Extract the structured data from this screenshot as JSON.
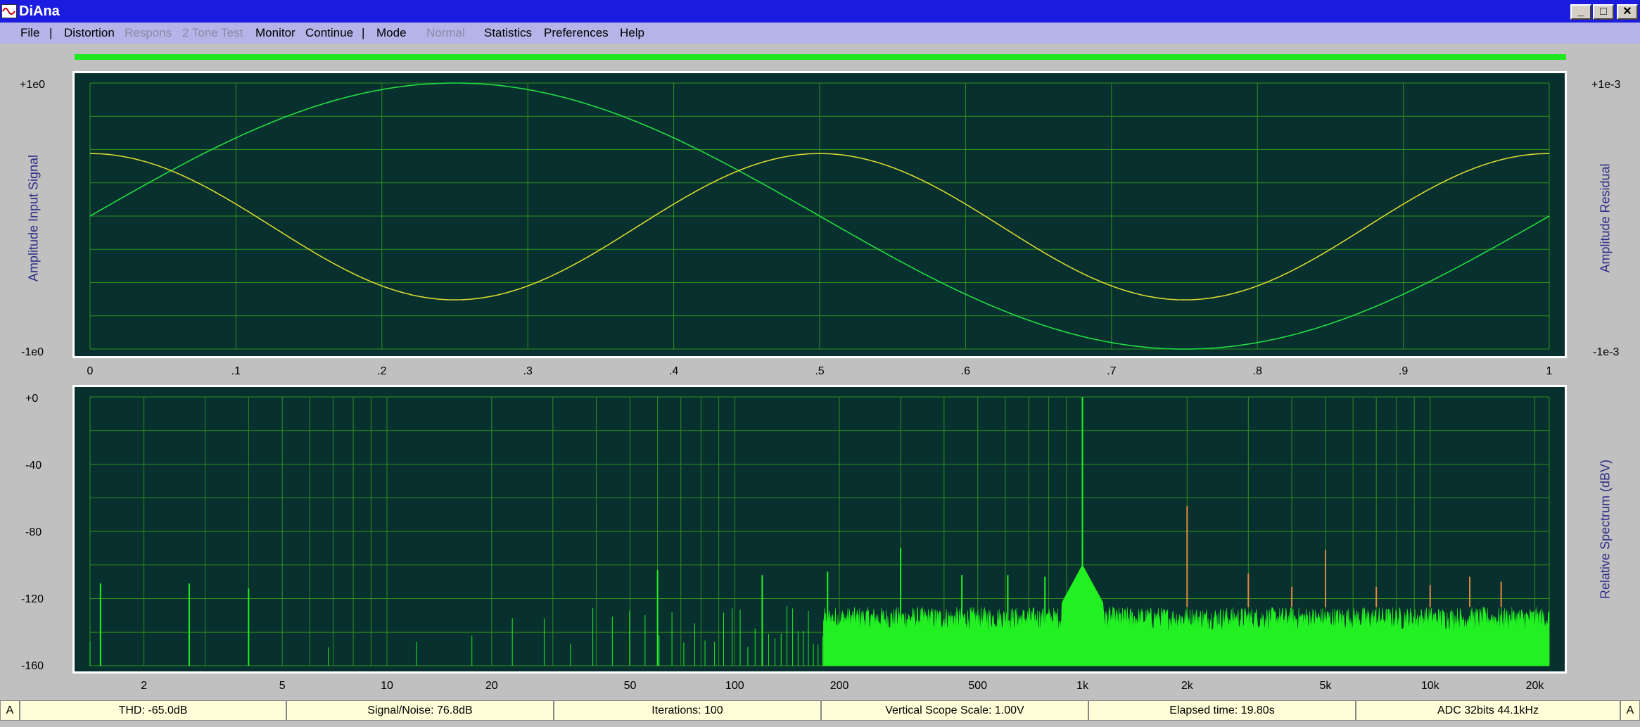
{
  "window": {
    "title": "DiAna",
    "minimize_label": "_",
    "maximize_label": "□",
    "close_label": "✕",
    "icon": "sine-wave-icon"
  },
  "menu": {
    "items": [
      {
        "label": "File",
        "enabled": true
      },
      {
        "label": "|",
        "separator": true
      },
      {
        "label": "Distortion",
        "enabled": true
      },
      {
        "label": "Respons",
        "enabled": false
      },
      {
        "label": "2 Tone Test",
        "enabled": false
      },
      {
        "label": "Monitor",
        "enabled": true
      },
      {
        "label": "Continue",
        "enabled": true
      },
      {
        "label": "|",
        "separator": true
      },
      {
        "label": "Mode",
        "enabled": true
      },
      {
        "label": "Normal",
        "enabled": false
      },
      {
        "label": "Statistics",
        "enabled": true
      },
      {
        "label": "Preferences",
        "enabled": true
      },
      {
        "label": "Help",
        "enabled": true
      }
    ]
  },
  "progress": {
    "fraction": 1.0,
    "color": "#1ee81e"
  },
  "colors": {
    "plot_bg": "#07302e",
    "grid": "#2f8f1f",
    "input_trace": "#22dd44",
    "residual_trace": "#d8d830",
    "spectrum_fill": "#22f022",
    "harmonic_marker": "#e08a40"
  },
  "chart_data": [
    {
      "type": "line",
      "left_axis_title": "Amplitude Input Signal",
      "right_axis_title": "Amplitude Residual",
      "left_ticks": [
        "+1e0",
        "-1e0"
      ],
      "right_ticks": [
        "+1e-3",
        "-1e-3"
      ],
      "x_ticks": [
        "0",
        ".1",
        ".2",
        ".3",
        ".4",
        ".5",
        ".6",
        ".7",
        ".8",
        ".9",
        "1"
      ],
      "xlim": [
        0,
        1
      ],
      "ylim": [
        -1,
        1
      ],
      "grid": true,
      "series": [
        {
          "color": "#22dd44",
          "amplitude": 1.0,
          "cycles": 1,
          "phase_deg": 0,
          "offset": 0
        },
        {
          "color": "#d8d830",
          "amplitude": 0.55,
          "cycles": 2,
          "phase_deg": 90,
          "offset": -0.08
        }
      ]
    },
    {
      "type": "area",
      "right_axis_title": "Relative Spectrum (dBV)",
      "y_ticks": [
        "+0",
        "-40",
        "-80",
        "-120",
        "-160"
      ],
      "ylim": [
        -160,
        0
      ],
      "x_scale": "log",
      "xlim": [
        1.4,
        22000
      ],
      "x_ticks": [
        "2",
        "5",
        "10",
        "20",
        "50",
        "100",
        "200",
        "500",
        "1k",
        "2k",
        "5k",
        "10k",
        "20k"
      ],
      "x_tick_values": [
        2,
        5,
        10,
        20,
        50,
        100,
        200,
        500,
        1000,
        2000,
        5000,
        10000,
        20000
      ],
      "grid": true,
      "fundamental": {
        "freq": 1000,
        "level": 0
      },
      "noise_floor": -128,
      "peaks": [
        {
          "freq": 1000,
          "level": -90
        },
        {
          "freq": 185,
          "level": -104
        },
        {
          "freq": 300,
          "level": -90
        },
        {
          "freq": 450,
          "level": -106
        },
        {
          "freq": 610,
          "level": -106
        },
        {
          "freq": 780,
          "level": -107
        },
        {
          "freq": 60,
          "level": -103
        },
        {
          "freq": 120,
          "level": -106
        },
        {
          "freq": 1.5,
          "level": -111
        },
        {
          "freq": 2.7,
          "level": -111
        },
        {
          "freq": 4,
          "level": -114
        }
      ],
      "harmonics": [
        {
          "freq": 2000,
          "level": -65
        },
        {
          "freq": 3000,
          "level": -105
        },
        {
          "freq": 4000,
          "level": -113
        },
        {
          "freq": 5000,
          "level": -91
        },
        {
          "freq": 7000,
          "level": -113
        },
        {
          "freq": 10000,
          "level": -112
        },
        {
          "freq": 13000,
          "level": -107
        },
        {
          "freq": 16000,
          "level": -110
        }
      ]
    }
  ],
  "status": {
    "left_edge": "A",
    "right_edge": "A",
    "cells": [
      "THD:  -65.0dB",
      "Signal/Noise:   76.8dB",
      "Iterations: 100",
      "Vertical Scope Scale: 1.00V",
      "Elapsed time: 19.80s",
      "ADC 32bits 44.1kHz"
    ]
  }
}
